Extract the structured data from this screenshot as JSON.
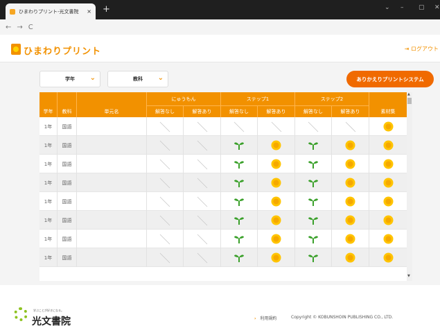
{
  "browser": {
    "tab_title": "ひまわりプリント-光文書院",
    "tab_close": "×",
    "new_tab": "+",
    "nav_back": "←",
    "nav_forward": "→",
    "nav_reload": "C",
    "win_min": "–",
    "win_max": "▢",
    "win_close": "✕",
    "win_chevron": "⌄"
  },
  "header": {
    "logo_text": "ひまわりプリント",
    "logout_label": "ログアウト",
    "logout_icon": "⇥"
  },
  "filters": {
    "grade_label": "学年",
    "subject_label": "教科",
    "system_button": "ありかえりプリントシステム"
  },
  "table": {
    "headers": {
      "grade": "学年",
      "subject": "教科",
      "unit": "単元名",
      "nyumon": "にゅうもん",
      "step1": "ステップ1",
      "step2": "ステップ2",
      "material": "素材集",
      "no_answer": "解答なし",
      "with_answer": "解答あり"
    },
    "rows": [
      {
        "grade": "1年",
        "subject": "国語",
        "unit": "",
        "step": false,
        "material": true
      },
      {
        "grade": "1年",
        "subject": "国語",
        "unit": "",
        "step": true,
        "material": true
      },
      {
        "grade": "1年",
        "subject": "国語",
        "unit": "",
        "step": true,
        "material": true
      },
      {
        "grade": "1年",
        "subject": "国語",
        "unit": "",
        "step": true,
        "material": true
      },
      {
        "grade": "1年",
        "subject": "国語",
        "unit": "",
        "step": true,
        "material": true
      },
      {
        "grade": "1年",
        "subject": "国語",
        "unit": "",
        "step": true,
        "material": true
      },
      {
        "grade": "1年",
        "subject": "国語",
        "unit": "",
        "step": true,
        "material": true
      },
      {
        "grade": "1年",
        "subject": "国語",
        "unit": "",
        "step": true,
        "material": true
      }
    ]
  },
  "footer": {
    "logo_sub": "学ぶことが好きになる。",
    "logo_text": "光文書院",
    "terms_link": "利用規約",
    "copyright": "Copyright © KOBUNSHOIN PUBLISHING CO., LTD."
  },
  "icons": {
    "sprout": "sprout-icon",
    "sunflower": "sunflower-icon",
    "slash": "slash-icon"
  },
  "colors": {
    "accent": "#f29100",
    "button": "#f06a00",
    "sprout": "#3aa02a",
    "sunflower": "#ffc400"
  }
}
